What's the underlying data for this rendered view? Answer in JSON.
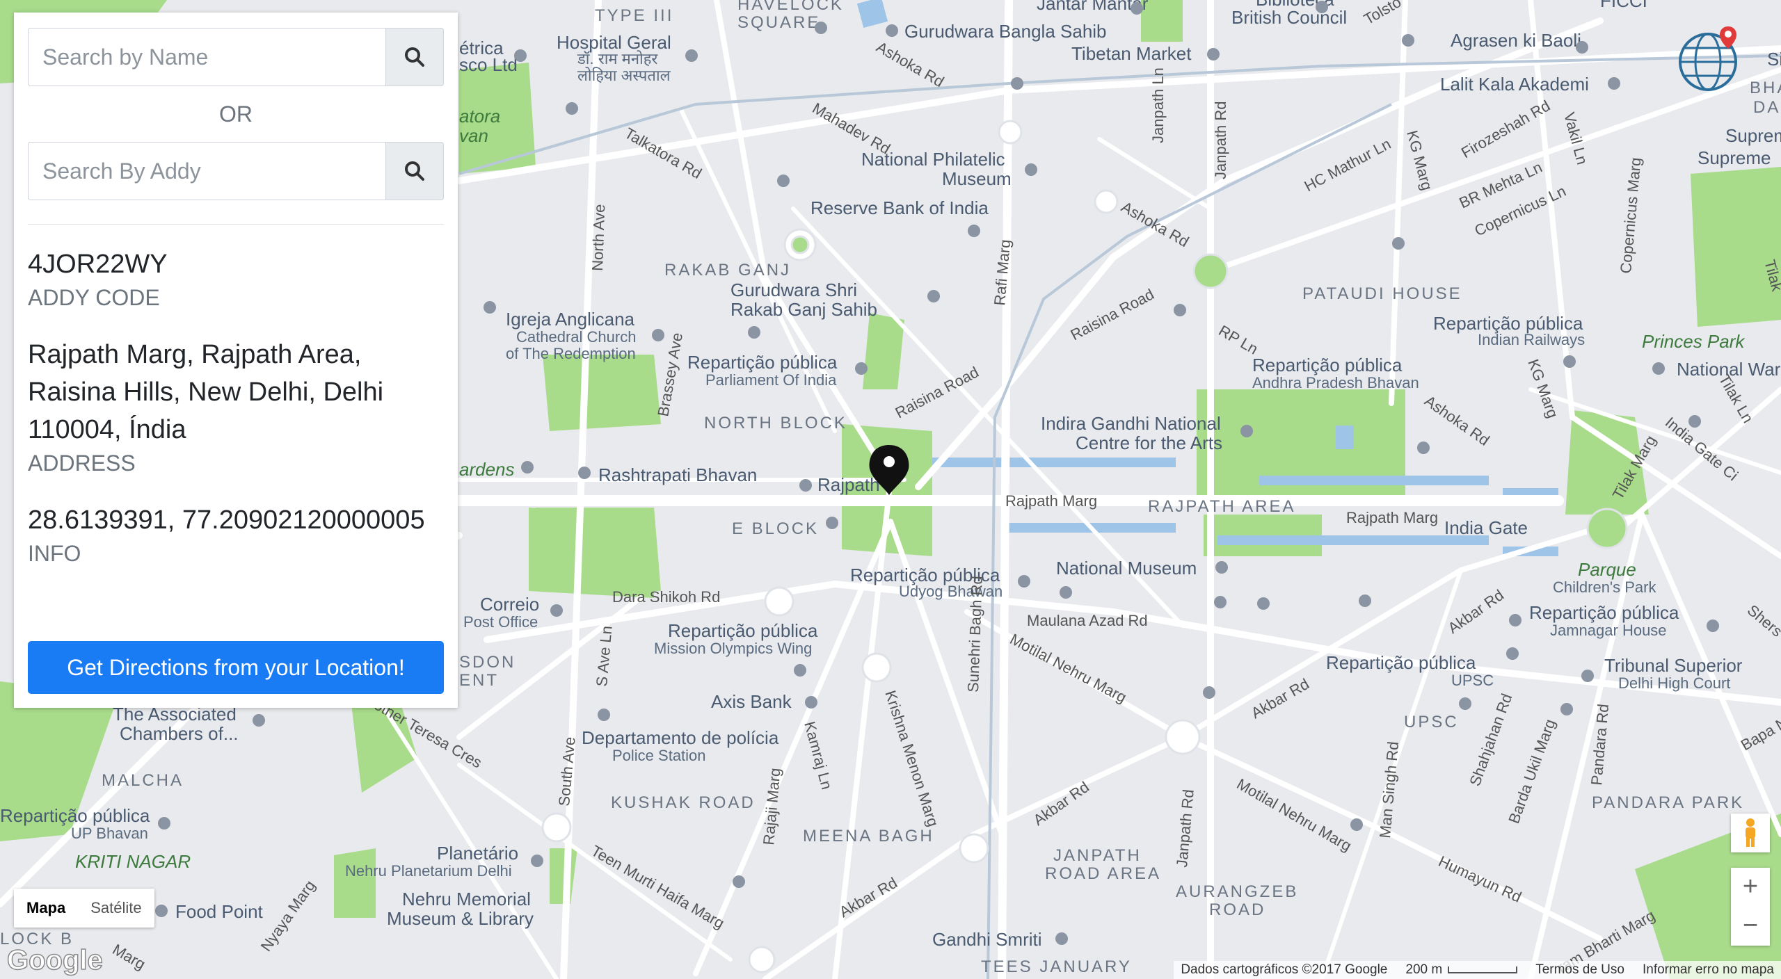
{
  "search": {
    "name_placeholder": "Search by Name",
    "or_text": "OR",
    "addy_placeholder": "Search By Addy"
  },
  "result": {
    "code": "4JOR22WY",
    "code_label": "ADDY CODE",
    "address_lines": [
      "Rajpath Marg, Rajpath Area,",
      "Raisina Hills, New Delhi, Delhi",
      "110004, Índia"
    ],
    "address_label": "ADDRESS",
    "coords": "28.6139391, 77.20902120000005",
    "coords_label": "INFO"
  },
  "directions_label": "Get Directions from your Location!",
  "map": {
    "labels": {
      "jantar": "Jantar Mantar",
      "biblioteca": "Biblioteca",
      "british_council": "British Council",
      "type3": "TYPE III",
      "havelock": "HAVELOCK",
      "square": "SQUARE",
      "gurudwara_bangla": "Gurudwara Bangla Sahib",
      "tibetan": "Tibetan Market",
      "agrasen": "Agrasen ki Baoli",
      "hospital": "Hospital Geral",
      "hospital_hi1": "डॉ. राम मनोहर",
      "hospital_hi2": "लोहिया अस्पताल",
      "etrica": "étrica",
      "sco": "sco Ltd",
      "atora": "atora",
      "van": "van",
      "lalit": "Lalit Kala Akademi",
      "ficci": "FICCI",
      "sikander": "Sikand",
      "bhag": "BHAG",
      "das": "DAS",
      "supreme": "Supreme",
      "supreme2": "Supreme",
      "phil1": "National Philatelic",
      "phil2": "Museum",
      "rbi": "Reserve Bank of India",
      "rakab": "RAKAB GANJ",
      "gurudwara_rakab1": "Gurudwara Shri",
      "gurudwara_rakab2": "Rakab Ganj Sahib",
      "pataudi": "PATAUDI HOUSE",
      "igreja1": "Igreja Anglicana",
      "igreja2": "Cathedral Church",
      "igreja3": "of The Redemption",
      "parl1": "Repartição pública",
      "parl2": "Parliament Of India",
      "rep_rail1": "Repartição pública",
      "rep_rail2": "Indian Railways",
      "princes": "Princes Park",
      "national_war": "National War",
      "rep_ap1": "Repartição pública",
      "rep_ap2": "Andhra Pradesh Bhavan",
      "north_block": "NORTH BLOCK",
      "ignca1": "Indira Gandhi National",
      "ignca2": "Centre for the Arts",
      "gardens": "ardens",
      "rashtrapati": "Rashtrapati Bhavan",
      "rajpath_lbl": "Rajpath",
      "rajpath_marg": "Rajpath Marg",
      "rajpath_area": "RAJPATH AREA",
      "rajpath_marg2": "Rajpath Marg",
      "india_gate": "India Gate",
      "e_block": "E BLOCK",
      "national_museum": "National Museum",
      "rep_udyog1": "Repartição pública",
      "rep_udyog2": "Udyog Bhawan",
      "dara": "Dara Shikoh Rd",
      "maulana": "Maulana Azad Rd",
      "parque": "Parque",
      "childrens": "Children's Park",
      "rep_jam1": "Repartição pública",
      "rep_jam2": "Jamnagar House",
      "correio1": "Correio",
      "correio2": "Post Office",
      "rep_mow1": "Repartição pública",
      "rep_mow2": "Mission Olympics Wing",
      "sdon": "SDON",
      "ent": "ENT",
      "rep_upsc1": "Repartição pública",
      "rep_upsc2": "UPSC",
      "tribunal1": "Tribunal Superior",
      "tribunal2": "Delhi High Court",
      "associated1": "The Associated",
      "associated2": "Chambers of...",
      "axis": "Axis Bank",
      "police1": "Departamento de polícia",
      "police2": "Police Station",
      "upsc": "UPSC",
      "malcha": "MALCHA",
      "rep_up1": "Repartição pública",
      "rep_up2": "UP Bhavan",
      "kriti": "KRITI NAGAR",
      "kushak": "KUSHAK ROAD",
      "meena": "MEENA BAGH",
      "pandara": "PANDARA PARK",
      "planetario1": "Planetário",
      "planetario2": "Nehru Planetarium Delhi",
      "janpath_area1": "JANPATH",
      "janpath_area2": "ROAD AREA",
      "aurangzeb1": "AURANGZEB",
      "aurangzeb2": "ROAD",
      "food_point": "Food Point",
      "nehru_mem1": "Nehru Memorial",
      "nehru_mem2": "Museum & Library",
      "lock_b": "LOCK B",
      "gandhi": "Gandhi Smriti",
      "tees": "TEES JANUARY"
    },
    "roads": {
      "ashoka1": "Ashoka Rd",
      "mahadev": "Mahadev Rd",
      "talkatora": "Talkatora Rd",
      "janpath_ln": "Janpath Ln",
      "janpath_rd": "Janpath Rd",
      "tolstoy": "Tolsto",
      "hc_mathur": "HC Mathur Ln",
      "kg_marg": "KG Marg",
      "firozeshah": "Firozeshah Rd",
      "vakil": "Vakil Ln",
      "br_mehta": "BR Mehta Ln",
      "copernicus": "Copernicus Ln",
      "copernicus_marg": "Copernicus Marg",
      "tilak_ln": "Tilak",
      "ashoka2": "Ashoka Rd",
      "rafi": "Rafi Marg",
      "raisina_rd": "Raisina Road",
      "raisina_road2": "Raisina Road",
      "rp_ln": "RP Ln",
      "north_ave": "North Ave",
      "brassey": "Brassey Ave",
      "ashoka3": "Ashoka Rd",
      "kg_marg2": "KG Marg",
      "tilak_ln2": "Tilak Ln",
      "india_gate_circ": "India Gate Ci",
      "tilak_marg": "Tilak Marg",
      "akbar1": "Akbar Rd",
      "shersha": "Shers",
      "s_ave": "S Ave Ln",
      "motilal1": "Motilal Nehru Marg",
      "akbar2": "Akbar Rd",
      "kamraj": "Kamraj Ln",
      "krishna": "Krishna Menon Marg",
      "sunehri": "Sunehri Bagh Rd",
      "south_ave": "South Ave",
      "mother_teresa": "other Teresa Cres",
      "rajaji": "Rajaji Marg",
      "akbar3": "Akbar Rd",
      "janpath_rd2": "Janpath Rd",
      "motilal2": "Motilal Nehru Marg",
      "man_singh": "Man Singh Rd",
      "shahjahan": "Shahjahan Rd",
      "barda": "Barda Ukil Marg",
      "pandara_rd": "Pandara Rd",
      "bapa": "Bapa N",
      "teen_murti": "Teen Murti Haifa Marg",
      "akbar4": "Akbar Rd",
      "humayun": "Humayun Rd",
      "nyaya": "Nyaya Marg",
      "marg_left": "Marg",
      "subram": "ram Bharti Marg",
      "tilak_top": "Tilak"
    }
  },
  "map_controls": {
    "map_label": "Mapa",
    "satellite_label": "Satélite",
    "zoom_in": "+",
    "zoom_out": "−"
  },
  "footer": {
    "data": "Dados cartográficos ©2017 Google",
    "scale": "200 m",
    "terms": "Termos de Uso",
    "report": "Informar erro no mapa"
  },
  "google_logo": "Google"
}
